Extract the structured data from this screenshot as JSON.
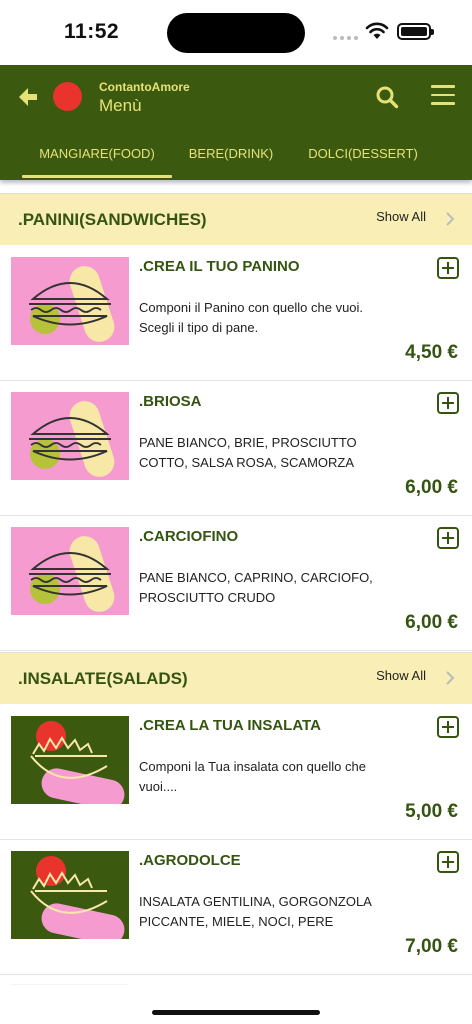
{
  "status_bar": {
    "time": "11:52"
  },
  "header": {
    "brand": "ContantoAmore",
    "title": "Menù",
    "tabs": [
      "MANGIARE(FOOD)",
      "BERE(DRINK)",
      "DOLCI(DESSERT)"
    ],
    "active_tab": "MANGIARE(FOOD)"
  },
  "icons": {
    "back": "arrow-left-icon",
    "search": "search-icon",
    "menu": "hamburger-menu-icon",
    "add": "plus-square-icon",
    "chevron": "chevron-right-icon"
  },
  "colors": {
    "header_bg": "#3b5a10",
    "accent": "#e6e176",
    "section_bg": "#f9efb6",
    "text_green": "#355412",
    "logo": "#e8342c",
    "panino_bg": "#f59bd0",
    "salad_bg": "#3b5a10"
  },
  "sections": [
    {
      "title": ".PANINI(SANDWICHES)",
      "show_all": "Show All",
      "items": [
        {
          "name": ".CREA IL TUO PANINO",
          "desc": "Componi il Panino con quello che vuoi. Scegli il tipo di pane.",
          "price": "4,50 €"
        },
        {
          "name": ".BRIOSA",
          "desc": "PANE BIANCO, BRIE, PROSCIUTTO COTTO, SALSA ROSA, SCAMORZA",
          "price": "6,00 €"
        },
        {
          "name": ".CARCIOFINO",
          "desc": "PANE BIANCO, CAPRINO, CARCIOFO, PROSCIUTTO CRUDO",
          "price": "6,00 €"
        }
      ]
    },
    {
      "title": ".INSALATE(SALADS)",
      "show_all": "Show All",
      "items": [
        {
          "name": ".CREA LA TUA INSALATA",
          "desc": "Componi la Tua insalata con quello che vuoi....",
          "price": "5,00 €"
        },
        {
          "name": ".AGRODOLCE",
          "desc": "INSALATA GENTILINA, GORGONZOLA PICCANTE, MIELE, NOCI, PERE",
          "price": "7,00 €"
        }
      ]
    }
  ]
}
